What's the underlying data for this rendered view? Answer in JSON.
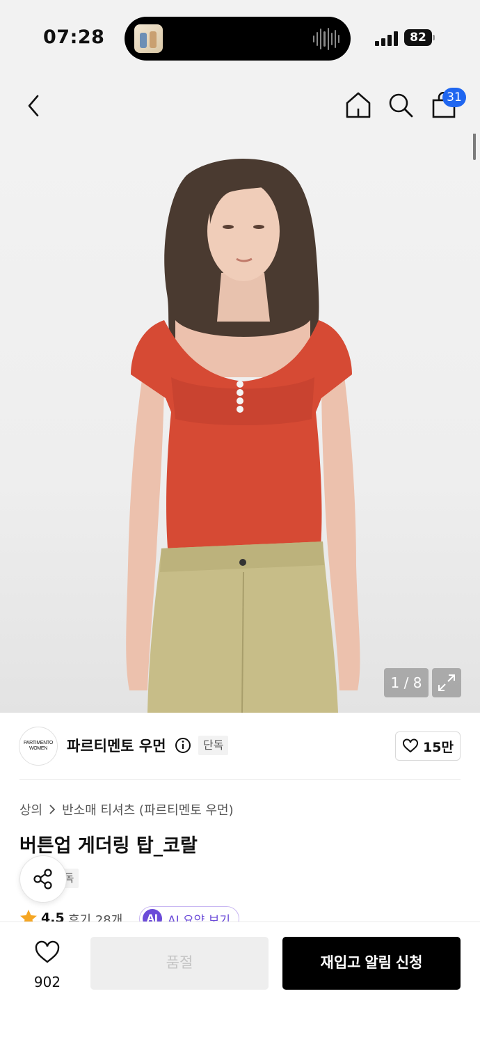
{
  "status_bar": {
    "time": "07:28",
    "battery": "82",
    "island_icon": "album-art-thumbnail",
    "wave_icon": "audio-waveform-icon",
    "signal_icon": "cellular-signal-icon"
  },
  "nav": {
    "back_icon": "chevron-left-icon",
    "home_icon": "home-icon",
    "search_icon": "search-icon",
    "cart_icon": "shopping-bag-icon",
    "cart_badge": "31",
    "badge_color": "#1f66f0"
  },
  "gallery": {
    "counter": "1 / 8",
    "expand_icon": "expand-arrows-icon"
  },
  "brand": {
    "logo_line1": "PARTIMENTO",
    "logo_line2": "WOMEN",
    "name": "파르티멘토 우먼",
    "info_icon": "info-circle-icon",
    "badge": "단독",
    "like_icon": "heart-outline-icon",
    "like_count": "15만"
  },
  "product": {
    "breadcrumb": [
      "상의",
      "반소매 티셔츠 (파르티멘토 우먼)"
    ],
    "title": "버튼업 게더링 탑_코랄",
    "badge": "단독",
    "share_icon": "share-icon",
    "rating": "4.5",
    "review_label": "후기 28개",
    "star_icon": "star-icon",
    "star_color": "#f5a623",
    "ai_badge": "AI",
    "ai_label": "AI 요약 보기",
    "ai_color": "#6b4bd8"
  },
  "bottom_bar": {
    "wish_icon": "heart-outline-icon",
    "wish_count": "902",
    "soldout_label": "품절",
    "restock_label": "재입고 알림 신청"
  }
}
